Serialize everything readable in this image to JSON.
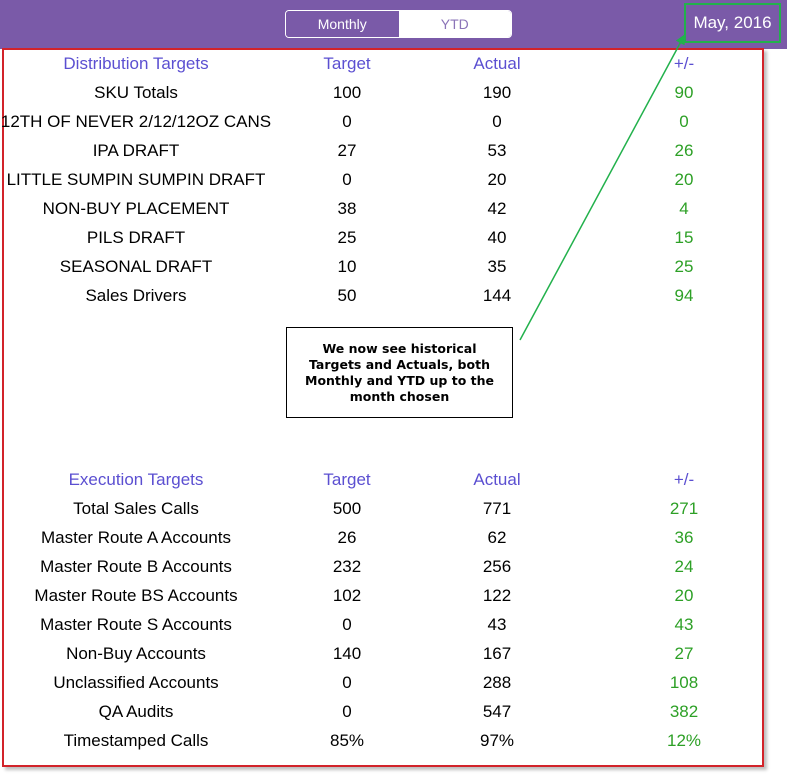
{
  "header": {
    "segments": [
      {
        "label": "Monthly",
        "active": true
      },
      {
        "label": "YTD",
        "active": false
      }
    ],
    "date_label": "May, 2016"
  },
  "distribution": {
    "headers": {
      "name": "Distribution Targets",
      "target": "Target",
      "actual": "Actual",
      "diff": "+/-"
    },
    "rows": [
      {
        "name": "SKU Totals",
        "target": "100",
        "actual": "190",
        "diff": "90"
      },
      {
        "name": "12TH OF NEVER 2/12/12OZ CANS",
        "target": "0",
        "actual": "0",
        "diff": "0"
      },
      {
        "name": "IPA DRAFT",
        "target": "27",
        "actual": "53",
        "diff": "26"
      },
      {
        "name": "LITTLE SUMPIN SUMPIN DRAFT",
        "target": "0",
        "actual": "20",
        "diff": "20"
      },
      {
        "name": "NON-BUY PLACEMENT",
        "target": "38",
        "actual": "42",
        "diff": "4"
      },
      {
        "name": "PILS DRAFT",
        "target": "25",
        "actual": "40",
        "diff": "15"
      },
      {
        "name": "SEASONAL DRAFT",
        "target": "10",
        "actual": "35",
        "diff": "25"
      },
      {
        "name": "Sales Drivers",
        "target": "50",
        "actual": "144",
        "diff": "94"
      }
    ]
  },
  "execution": {
    "headers": {
      "name": "Execution Targets",
      "target": "Target",
      "actual": "Actual",
      "diff": "+/-"
    },
    "rows": [
      {
        "name": "Total Sales Calls",
        "target": "500",
        "actual": "771",
        "diff": "271"
      },
      {
        "name": "Master Route A Accounts",
        "target": "26",
        "actual": "62",
        "diff": "36"
      },
      {
        "name": "Master Route B Accounts",
        "target": "232",
        "actual": "256",
        "diff": "24"
      },
      {
        "name": "Master Route BS Accounts",
        "target": "102",
        "actual": "122",
        "diff": "20"
      },
      {
        "name": "Master Route S Accounts",
        "target": "0",
        "actual": "43",
        "diff": "43"
      },
      {
        "name": "Non-Buy Accounts",
        "target": "140",
        "actual": "167",
        "diff": "27"
      },
      {
        "name": "Unclassified Accounts",
        "target": "0",
        "actual": "288",
        "diff": "108"
      },
      {
        "name": "QA Audits",
        "target": "0",
        "actual": "547",
        "diff": "382"
      },
      {
        "name": "Timestamped Calls",
        "target": "85%",
        "actual": "97%",
        "diff": "12%"
      }
    ]
  },
  "callout": {
    "text": "We now see historical Targets and Actuals, both Monthly and YTD up to the month chosen"
  },
  "colors": {
    "header_bg": "#7a5aa8",
    "section_header": "#5b4fd1",
    "diff_value": "#2da026",
    "frame_border": "#d2232a",
    "highlight_border": "#22b14c"
  }
}
